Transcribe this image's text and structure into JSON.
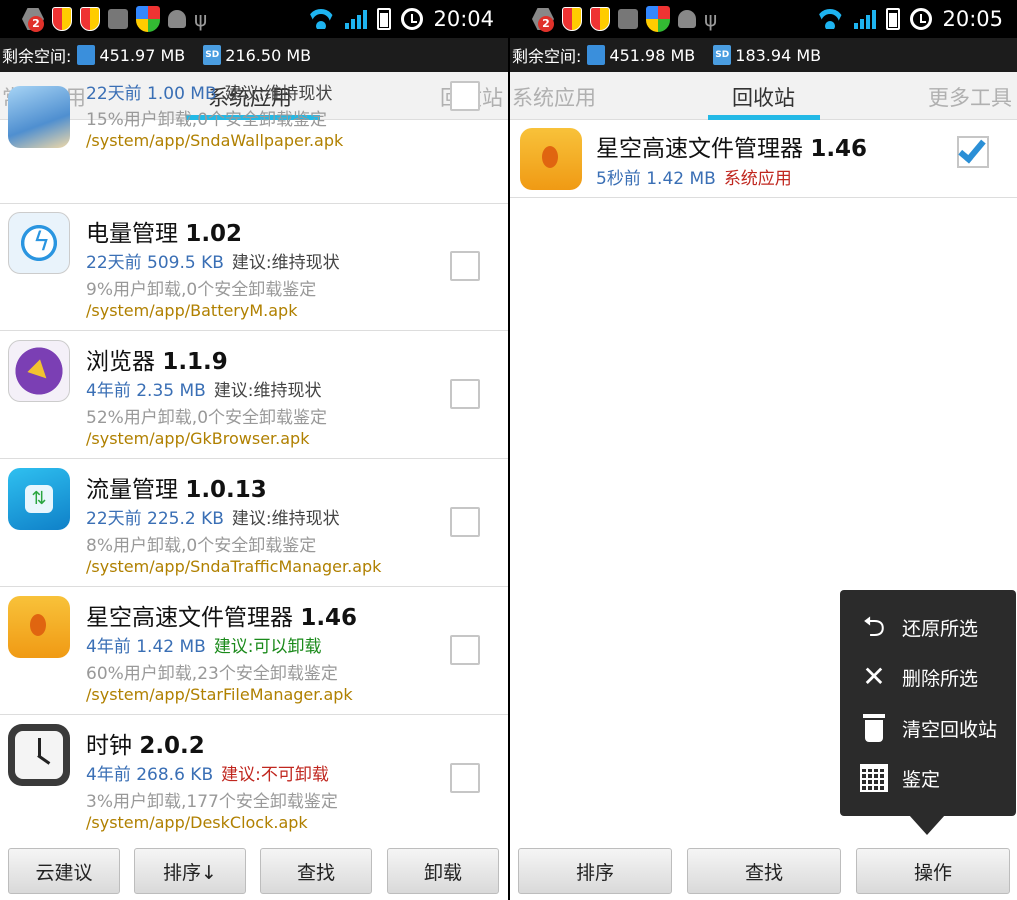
{
  "left": {
    "status": {
      "time": "20:04",
      "notif_count": "2"
    },
    "storage": {
      "label": "剩余空间:",
      "internal": "451.97 MB",
      "sd_label": "SD",
      "sd": "216.50 MB"
    },
    "tabs": [
      "常规应用",
      "系统应用",
      "回收站"
    ],
    "active_tab": "系统应用",
    "apps": [
      {
        "name": "",
        "version": "",
        "meta": "22天前 1.00 MB",
        "advice": "建议:维持现状",
        "advice_color": "gray",
        "stats": "15%用户卸载,0个安全卸载鉴定",
        "path": "/system/app/SndaWallpaper.apk",
        "icon": "wallpaper-icon"
      },
      {
        "name": "电量管理",
        "version": "1.02",
        "meta": "22天前 509.5 KB",
        "advice": "建议:维持现状",
        "advice_color": "gray",
        "stats": "9%用户卸载,0个安全卸载鉴定",
        "path": "/system/app/BatteryM.apk",
        "icon": "battery-manager-icon"
      },
      {
        "name": "浏览器",
        "version": "1.1.9",
        "meta": "4年前 2.35 MB",
        "advice": "建议:维持现状",
        "advice_color": "gray",
        "stats": "52%用户卸载,0个安全卸载鉴定",
        "path": "/system/app/GkBrowser.apk",
        "icon": "browser-compass-icon"
      },
      {
        "name": "流量管理",
        "version": "1.0.13",
        "meta": "22天前 225.2 KB",
        "advice": "建议:维持现状",
        "advice_color": "gray",
        "stats": "8%用户卸载,0个安全卸载鉴定",
        "path": "/system/app/SndaTrafficManager.apk",
        "icon": "traffic-manager-icon"
      },
      {
        "name": "星空高速文件管理器",
        "version": "1.46",
        "meta": "4年前 1.42 MB",
        "advice": "建议:可以卸载",
        "advice_color": "green",
        "stats": "60%用户卸载,23个安全卸载鉴定",
        "path": "/system/app/StarFileManager.apk",
        "icon": "file-manager-folder-icon"
      },
      {
        "name": "时钟",
        "version": "2.0.2",
        "meta": "4年前 268.6 KB",
        "advice": "建议:不可卸载",
        "advice_color": "red",
        "stats": "3%用户卸载,177个安全卸载鉴定",
        "path": "/system/app/DeskClock.apk",
        "icon": "clock-icon"
      }
    ],
    "buttons": [
      "云建议",
      "排序↓",
      "查找",
      "卸载"
    ]
  },
  "right": {
    "status": {
      "time": "20:05",
      "notif_count": "2"
    },
    "storage": {
      "label": "剩余空间:",
      "internal": "451.98 MB",
      "sd_label": "SD",
      "sd": "183.94 MB"
    },
    "tabs": [
      "系统应用",
      "回收站",
      "更多工具"
    ],
    "active_tab": "回收站",
    "item": {
      "name": "星空高速文件管理器",
      "version": "1.46",
      "meta": "5秒前 1.42 MB",
      "tag": "系统应用",
      "checked": true
    },
    "menu": [
      {
        "label": "还原所选",
        "icon": "undo-icon"
      },
      {
        "label": "删除所选",
        "icon": "close-icon"
      },
      {
        "label": "清空回收站",
        "icon": "trash-icon"
      },
      {
        "label": "鉴定",
        "icon": "calendar-icon"
      }
    ],
    "buttons": [
      "排序",
      "查找",
      "操作"
    ]
  },
  "colors": {
    "accent": "#23b9e6",
    "meta_blue": "#3a6fb5",
    "path_gold": "#b08000",
    "advice_green": "#1a8a1a",
    "advice_red": "#c0271f"
  }
}
